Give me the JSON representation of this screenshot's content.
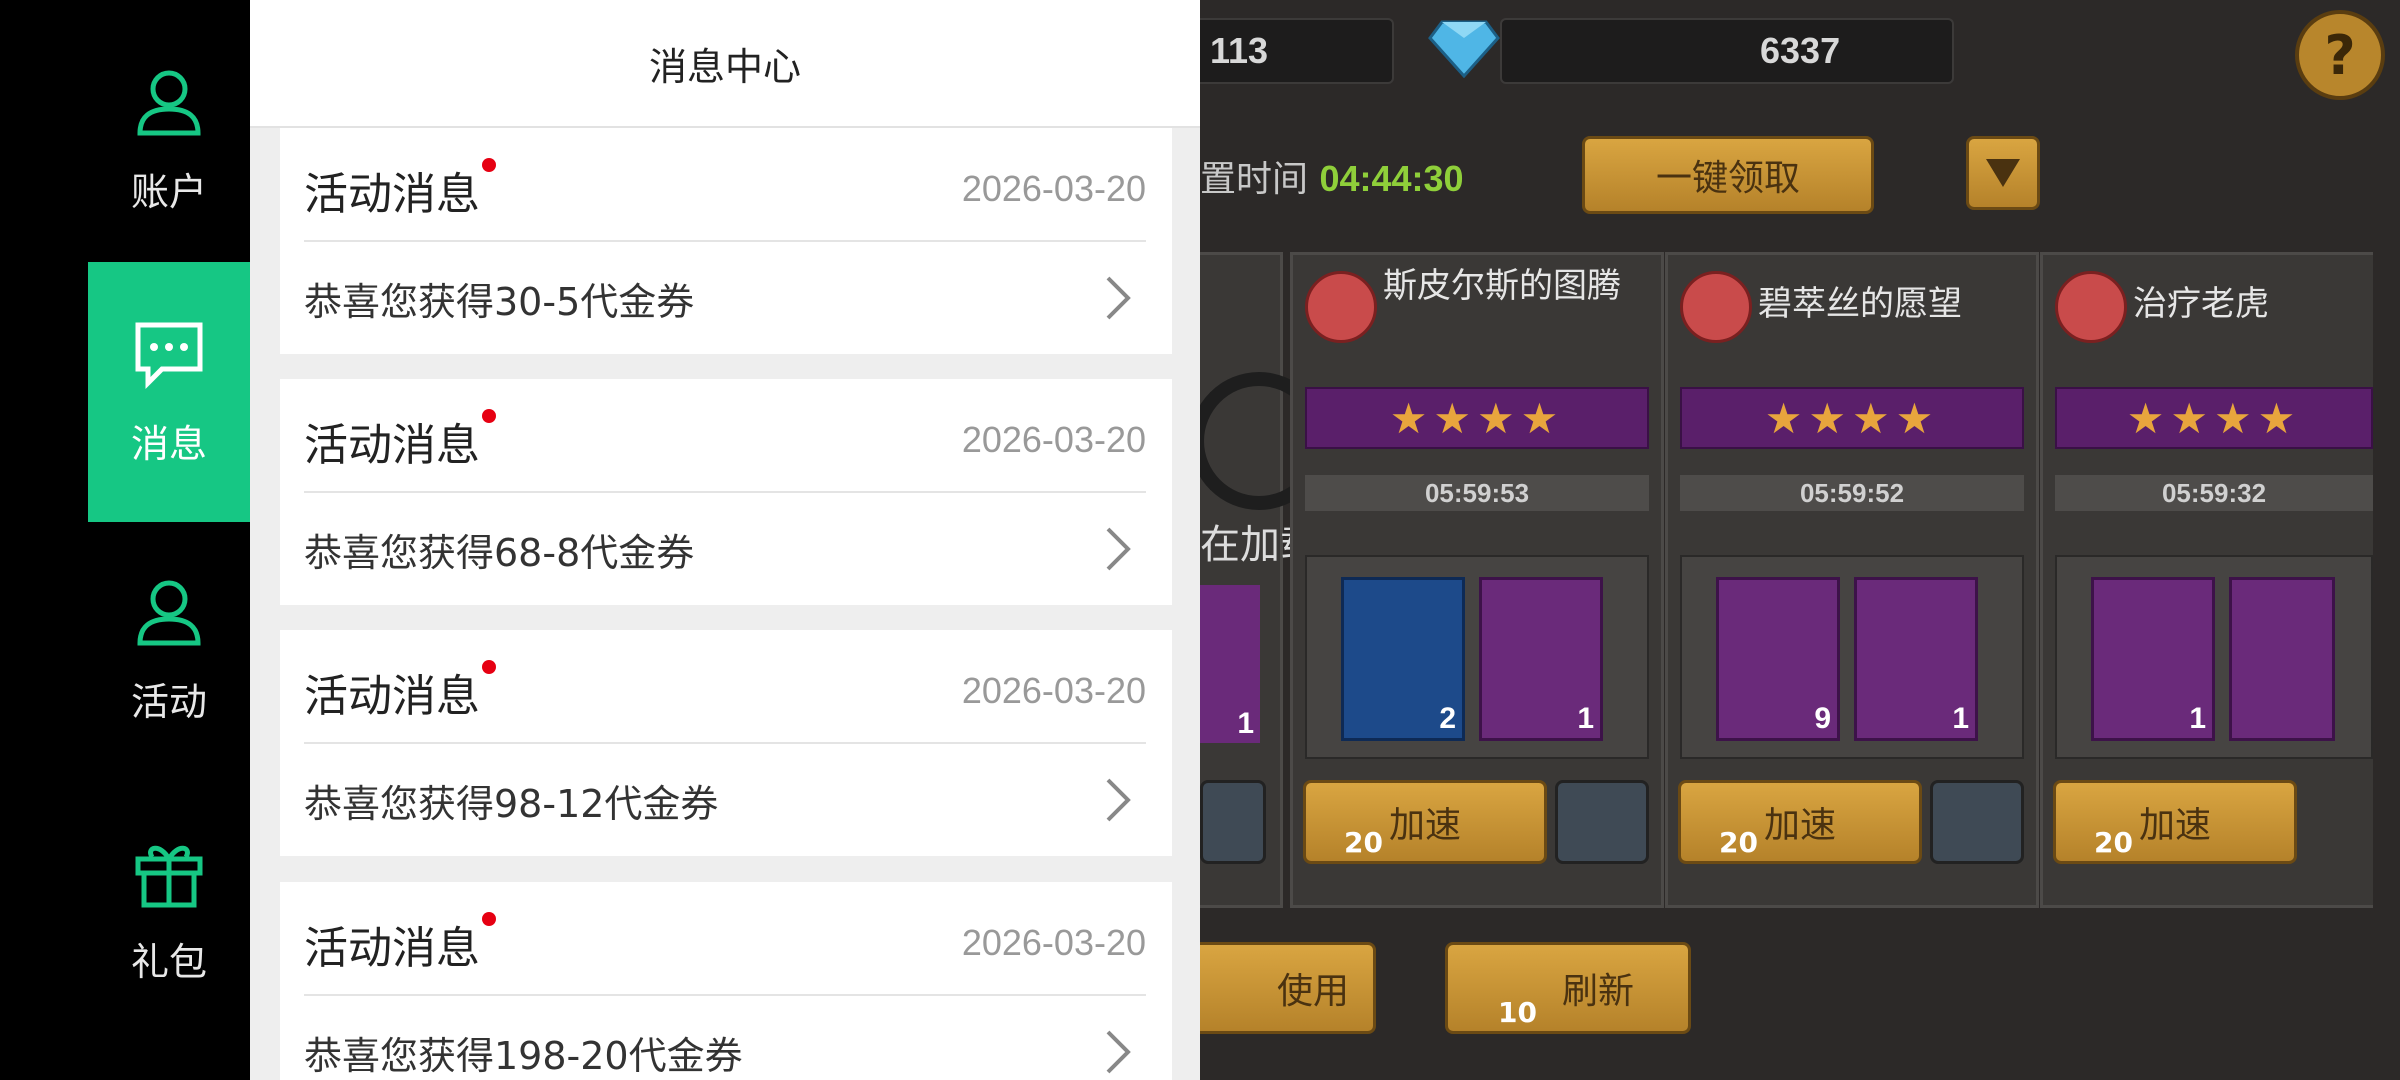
{
  "sidebar": {
    "items": [
      {
        "label": "账户",
        "icon": "user-icon"
      },
      {
        "label": "消息",
        "icon": "chat-icon",
        "active": true
      },
      {
        "label": "活动",
        "icon": "user-icon"
      },
      {
        "label": "礼包",
        "icon": "gift-icon"
      }
    ],
    "accent": "#16c784"
  },
  "panel": {
    "title": "消息中心",
    "messages": [
      {
        "title": "活动消息",
        "date": "2026-03-20",
        "body": "恭喜您获得30-5代金券",
        "unread": true
      },
      {
        "title": "活动消息",
        "date": "2026-03-20",
        "body": "恭喜您获得68-8代金券",
        "unread": true
      },
      {
        "title": "活动消息",
        "date": "2026-03-20",
        "body": "恭喜您获得98-12代金券",
        "unread": true
      },
      {
        "title": "活动消息",
        "date": "2026-03-20",
        "body": "恭喜您获得198-20代金券",
        "unread": true
      }
    ]
  },
  "game": {
    "resource_1": "113",
    "diamonds": "6337",
    "help": "?",
    "reset_label": "置时间",
    "reset_time": "04:44:30",
    "claim_all": "一键领取",
    "loading_text": "在加载",
    "cards": [
      {
        "title": "斯皮尔斯的图腾",
        "stars": "★★★★",
        "timer": "05:59:53",
        "rewards": [
          "2",
          "1"
        ],
        "speed": "加速",
        "cost": "20"
      },
      {
        "title": "碧萃丝的愿望",
        "stars": "★★★★",
        "timer": "05:59:52",
        "rewards": [
          "9",
          "1"
        ],
        "speed": "加速",
        "cost": "20"
      },
      {
        "title": "治疗老虎",
        "stars": "★★★★",
        "timer": "05:59:32",
        "rewards": [
          "1",
          ""
        ],
        "speed": "加速",
        "cost": "20"
      }
    ],
    "partial_reward_count": "1",
    "use_label": "使用",
    "refresh_label": "刷新",
    "refresh_cost": "10"
  }
}
